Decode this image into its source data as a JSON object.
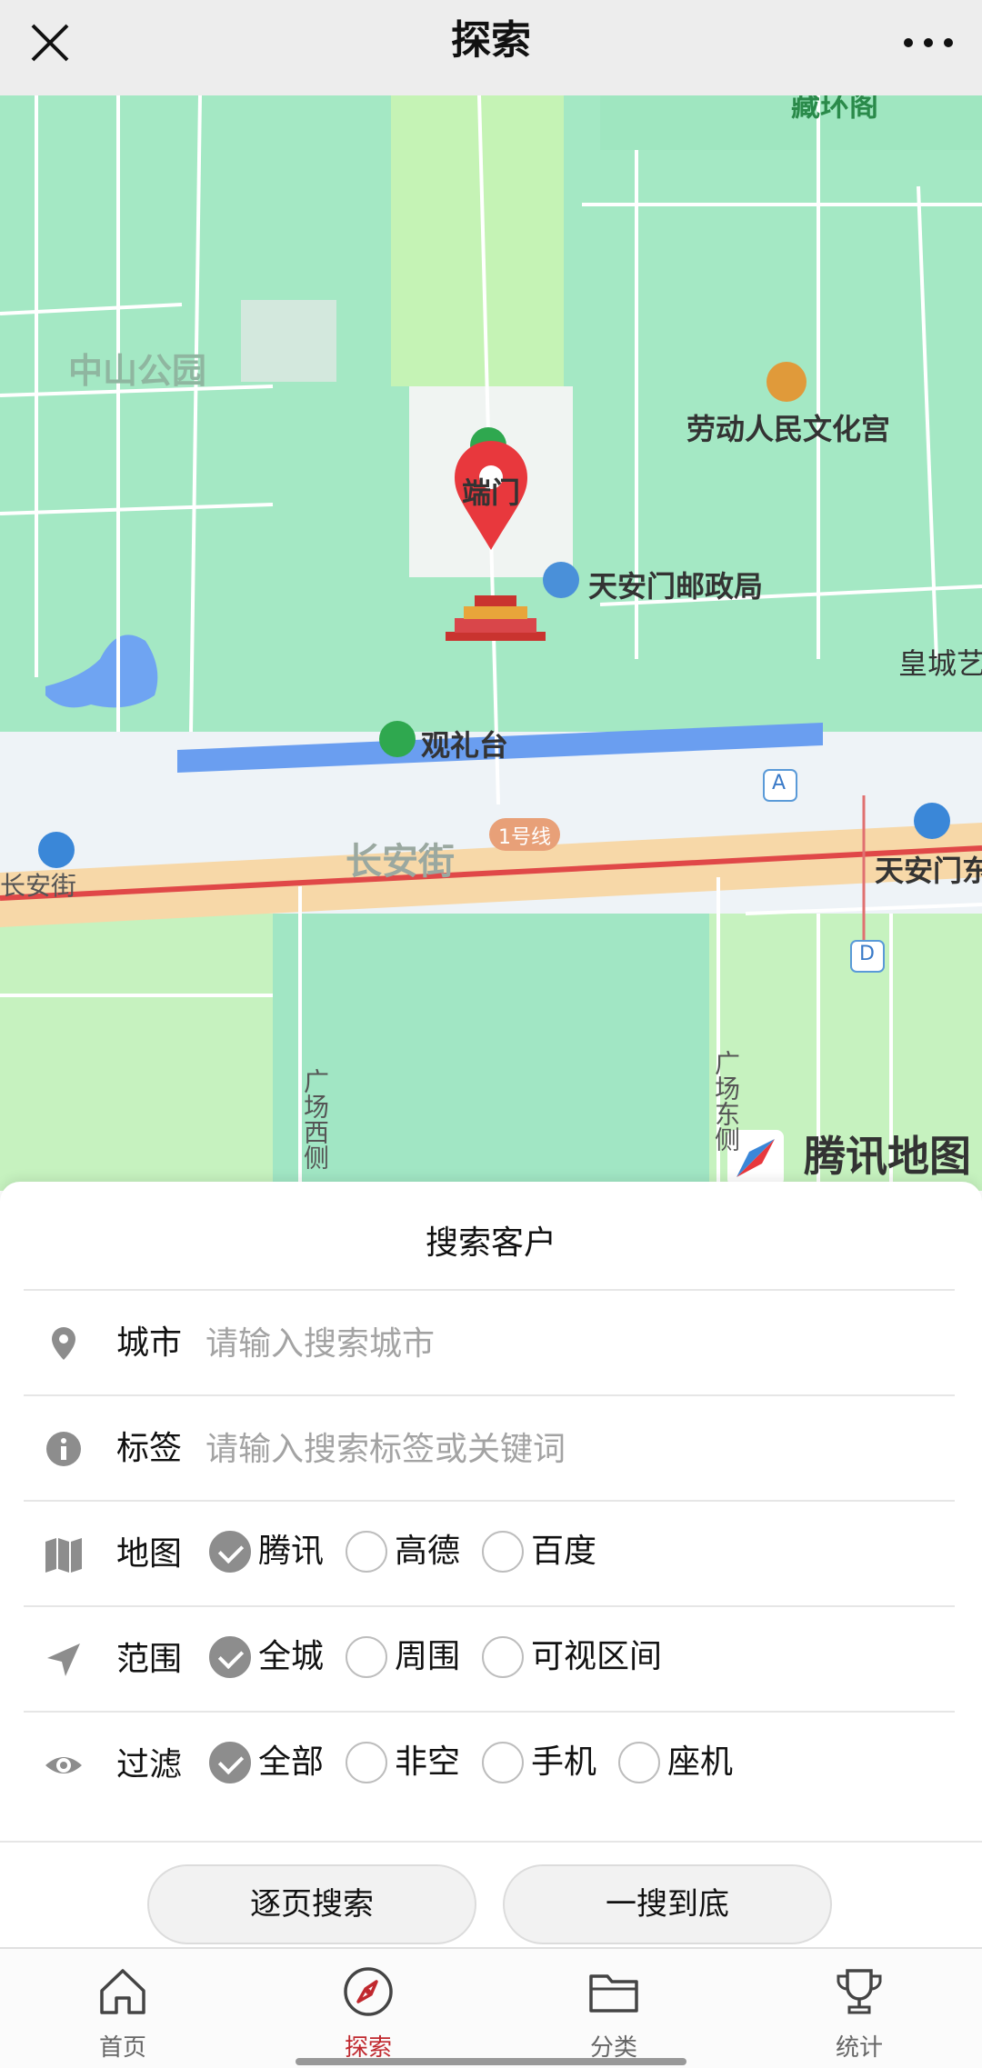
{
  "header": {
    "title": "探索"
  },
  "map": {
    "labels": {
      "zhongshan_park": "中山公园",
      "duanmen": "端门",
      "labor_palace": "劳动人民文化宫",
      "post_office": "天安门邮政局",
      "guanlitai": "观礼台",
      "changan_street": "长安街",
      "changan_street_left": "长安街",
      "line1": "1号线",
      "tiananmen_east": "天安门东",
      "huangcheng": "皇城艺",
      "top_cut": "藏环阁",
      "square_west": "广场西侧",
      "square_east": "广场东侧",
      "exit_a": "A",
      "exit_d": "D"
    },
    "brand": "腾讯地图"
  },
  "panel": {
    "title": "搜索客户",
    "city": {
      "label": "城市",
      "placeholder": "请输入搜索城市",
      "value": ""
    },
    "tag": {
      "label": "标签",
      "placeholder": "请输入搜索标签或关键词",
      "value": ""
    },
    "map_source": {
      "label": "地图",
      "options": [
        "腾讯",
        "高德",
        "百度"
      ],
      "selected": "腾讯"
    },
    "range": {
      "label": "范围",
      "options": [
        "全城",
        "周围",
        "可视区间"
      ],
      "selected": "全城"
    },
    "filter": {
      "label": "过滤",
      "options": [
        "全部",
        "非空",
        "手机",
        "座机"
      ],
      "selected": "全部"
    },
    "buttons": {
      "page_search": "逐页搜索",
      "full_search": "一搜到底"
    }
  },
  "tabbar": {
    "items": [
      {
        "label": "首页",
        "icon": "home-icon",
        "active": false
      },
      {
        "label": "探索",
        "icon": "compass-icon",
        "active": true
      },
      {
        "label": "分类",
        "icon": "folder-icon",
        "active": false
      },
      {
        "label": "统计",
        "icon": "trophy-icon",
        "active": false
      }
    ]
  },
  "colors": {
    "accent": "#c0282e",
    "map_green": "#a4e8c4",
    "checked": "#8d8d8d"
  }
}
